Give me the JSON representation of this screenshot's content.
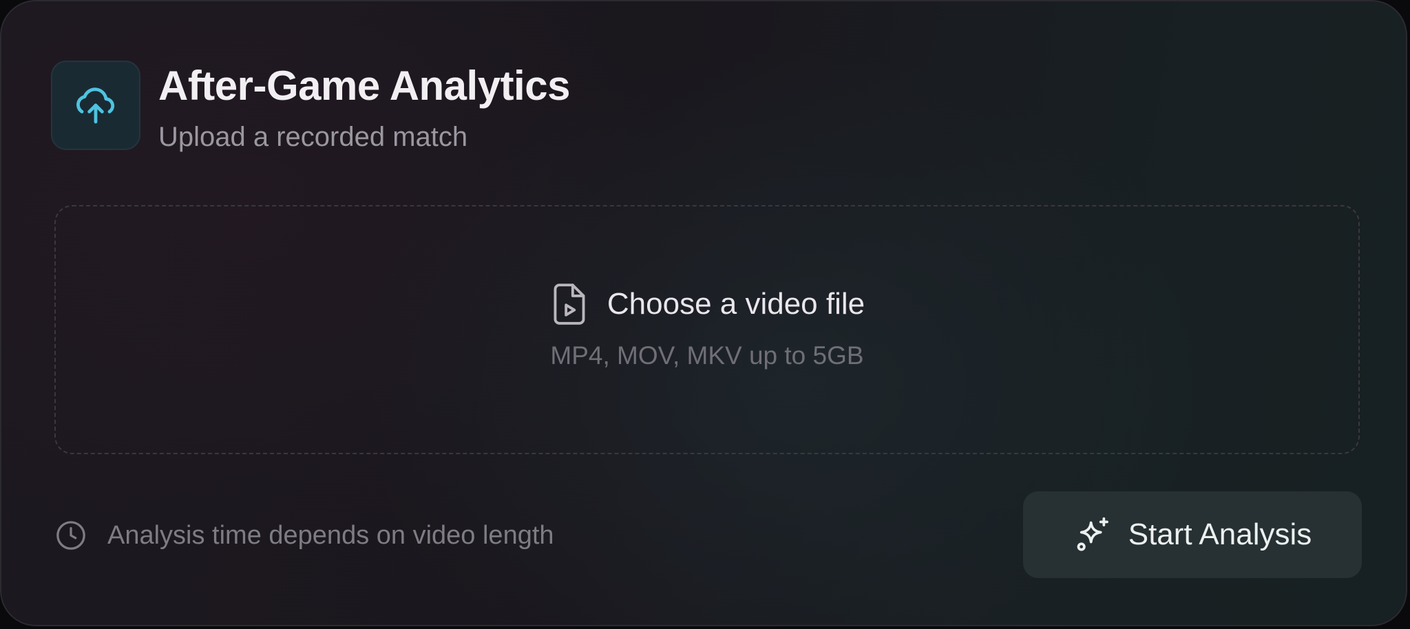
{
  "header": {
    "title": "After-Game Analytics",
    "subtitle": "Upload a recorded match",
    "icon": "cloud-upload-icon",
    "icon_color": "#4fc3e0"
  },
  "dropzone": {
    "label": "Choose a video file",
    "hint": "MP4, MOV, MKV up to 5GB",
    "icon": "video-file-icon"
  },
  "footer": {
    "note": "Analysis time depends on video length",
    "note_icon": "clock-icon",
    "start_button_label": "Start Analysis",
    "start_button_icon": "sparkles-icon"
  }
}
